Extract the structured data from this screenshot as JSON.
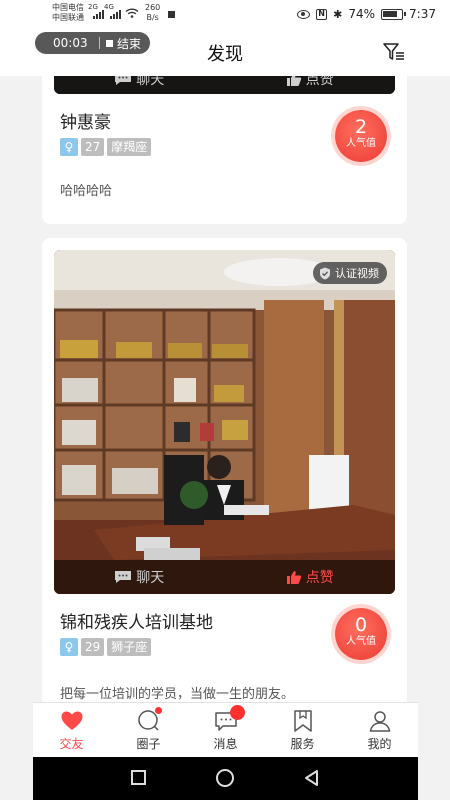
{
  "status_bar": {
    "carrier_1": "中国电信",
    "carrier_2": "中国联通",
    "signal_1": "2G",
    "signal_2": "4G",
    "net_speed_value": "260",
    "net_speed_unit": "B/s",
    "nfc": "N",
    "battery": "74%",
    "time": "7:37"
  },
  "recording": {
    "time": "00:03",
    "end_label": "结束"
  },
  "header": {
    "title": "发现",
    "filter_icon": "filter-icon"
  },
  "posts": [
    {
      "name": "钟惠豪",
      "age": "27",
      "zodiac": "摩羯座",
      "gender_icon": "female-icon",
      "bio": "哈哈哈哈",
      "popularity": "2",
      "popularity_label": "人气值",
      "chat_label": "聊天",
      "like_label": "点赞",
      "liked": false
    },
    {
      "name": "锦和残疾人培训基地",
      "age": "29",
      "zodiac": "狮子座",
      "gender_icon": "female-icon",
      "bio": "把每一位培训的学员，当做一生的朋友。",
      "popularity": "0",
      "popularity_label": "人气值",
      "chat_label": "聊天",
      "like_label": "点赞",
      "liked": true,
      "verified_label": "认证视频"
    }
  ],
  "bottom_nav": [
    {
      "label": "交友",
      "icon": "heart-icon",
      "active": true,
      "badge": false
    },
    {
      "label": "圈子",
      "icon": "circle-icon",
      "active": false,
      "badge": true
    },
    {
      "label": "消息",
      "icon": "message-icon",
      "active": false,
      "badge": true
    },
    {
      "label": "服务",
      "icon": "bookmark-icon",
      "active": false,
      "badge": false
    },
    {
      "label": "我的",
      "icon": "user-icon",
      "active": false,
      "badge": false
    }
  ],
  "colors": {
    "accent": "#ff4a48",
    "gender_tag": "#8ec7ec",
    "info_tag": "#bdbdbd"
  }
}
